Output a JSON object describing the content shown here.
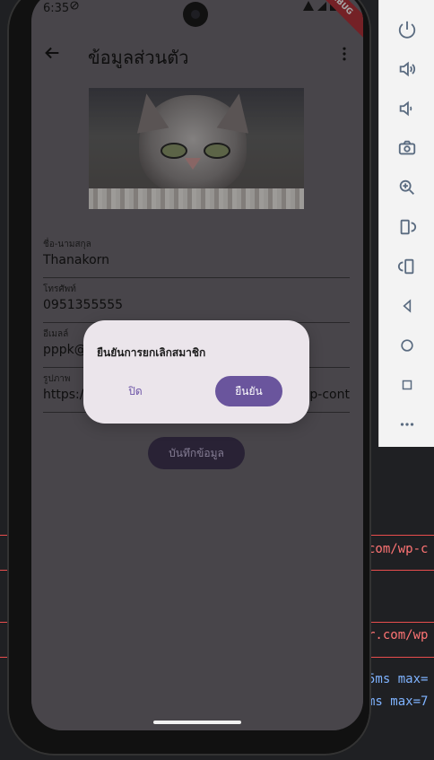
{
  "status_bar": {
    "time": "6:35",
    "debug_label": "DEBUG"
  },
  "app": {
    "title": "ข้อมูลส่วนตัว"
  },
  "profile": {
    "fields": [
      {
        "label": "ชื่อ-นามสกุล",
        "value": "Thanakorn"
      },
      {
        "label": "โทรศัพท์",
        "value": "0951355555"
      },
      {
        "label": "อีเมลล์",
        "value": "pppk@"
      },
      {
        "label": "รูปภาพ",
        "value": "https://",
        "suffix": "p-cont"
      }
    ],
    "save_label": "บันทึกข้อมูล"
  },
  "dialog": {
    "title": "ยืนยันการยกเลิกสมาชิก",
    "close_label": "ปิด",
    "confirm_label": "ยืนยัน"
  },
  "ide_snippets": {
    "url_1": "com/wp-c",
    "url_2": "r.com/wp",
    "timing_1": "5ms max=",
    "timing_2": "ms max=7"
  }
}
